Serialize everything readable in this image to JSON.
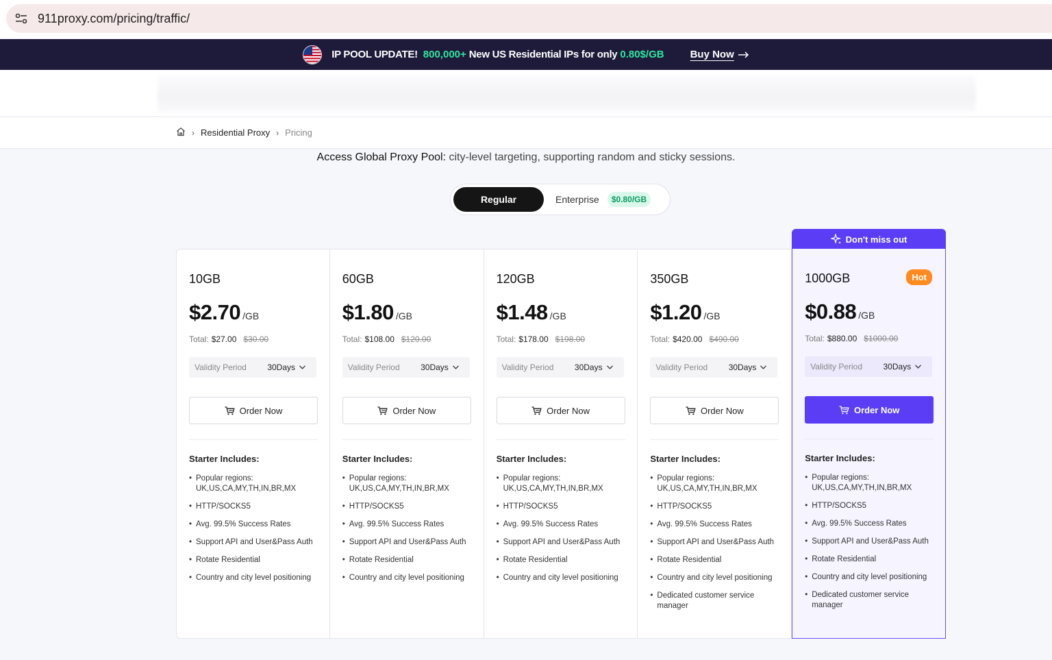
{
  "browser": {
    "url": "911proxy.com/pricing/traffic/"
  },
  "promo": {
    "headline": "IP POOL UPDATE!",
    "count": "800,000+",
    "text": "New US Residential IPs for only",
    "price": "0.80$/GB",
    "cta": "Buy Now"
  },
  "breadcrumb": {
    "items": [
      "Residential Proxy",
      "Pricing"
    ]
  },
  "subtitle": {
    "strong": "Access Global Proxy Pool:",
    "rest": " city-level targeting, supporting random and sticky sessions."
  },
  "plan_toggle": {
    "regular": "Regular",
    "enterprise": "Enterprise",
    "enterprise_badge": "$0.80/GB"
  },
  "ribbon": "Don't miss out",
  "cards": [
    {
      "gb": "10GB",
      "price": "$2.70",
      "unit": "/GB",
      "total_label": "Total:",
      "total": "$27.00",
      "old": "$30.00",
      "validity_label": "Validity Period",
      "validity": "30Days",
      "order": "Order Now",
      "includes": "Starter Includes:",
      "features": [
        "Popular regions: UK,US,CA,MY,TH,IN,BR,MX",
        "HTTP/SOCKS5",
        "Avg. 99.5% Success Rates",
        "Support API and User&Pass Auth",
        "Rotate Residential",
        "Country and city level positioning"
      ]
    },
    {
      "gb": "60GB",
      "price": "$1.80",
      "unit": "/GB",
      "total_label": "Total:",
      "total": "$108.00",
      "old": "$120.00",
      "validity_label": "Validity Period",
      "validity": "30Days",
      "order": "Order Now",
      "includes": "Starter Includes:",
      "features": [
        "Popular regions: UK,US,CA,MY,TH,IN,BR,MX",
        "HTTP/SOCKS5",
        "Avg. 99.5% Success Rates",
        "Support API and User&Pass Auth",
        "Rotate Residential",
        "Country and city level positioning"
      ]
    },
    {
      "gb": "120GB",
      "price": "$1.48",
      "unit": "/GB",
      "total_label": "Total:",
      "total": "$178.00",
      "old": "$198.00",
      "validity_label": "Validity Period",
      "validity": "30Days",
      "order": "Order Now",
      "includes": "Starter Includes:",
      "features": [
        "Popular regions: UK,US,CA,MY,TH,IN,BR,MX",
        "HTTP/SOCKS5",
        "Avg. 99.5% Success Rates",
        "Support API and User&Pass Auth",
        "Rotate Residential",
        "Country and city level positioning"
      ]
    },
    {
      "gb": "350GB",
      "price": "$1.20",
      "unit": "/GB",
      "total_label": "Total:",
      "total": "$420.00",
      "old": "$490.00",
      "validity_label": "Validity Period",
      "validity": "30Days",
      "order": "Order Now",
      "includes": "Starter Includes:",
      "features": [
        "Popular regions: UK,US,CA,MY,TH,IN,BR,MX",
        "HTTP/SOCKS5",
        "Avg. 99.5% Success Rates",
        "Support API and User&Pass Auth",
        "Rotate Residential",
        "Country and city level positioning",
        "Dedicated customer service manager"
      ]
    },
    {
      "gb": "1000GB",
      "hot": "Hot",
      "price": "$0.88",
      "unit": "/GB",
      "total_label": "Total:",
      "total": "$880.00",
      "old": "$1000.00",
      "validity_label": "Validity Period",
      "validity": "30Days",
      "order": "Order Now",
      "includes": "Starter Includes:",
      "features": [
        "Popular regions: UK,US,CA,MY,TH,IN,BR,MX",
        "HTTP/SOCKS5",
        "Avg. 99.5% Success Rates",
        "Support API and User&Pass Auth",
        "Rotate Residential",
        "Country and city level positioning",
        "Dedicated customer service manager"
      ]
    }
  ],
  "colors": {
    "accent": "#5b3df5",
    "banner_bg": "#1e1b3a",
    "banner_green": "#2ee8a0",
    "hot": "#ff8a1f",
    "badge_green": "#0d9a63"
  },
  "icons": {
    "site_info": "tune-icon",
    "home": "home-icon",
    "cart": "cart-icon",
    "sparkle": "sparkle-icon",
    "chevron": "chevron-down-icon",
    "arrow": "arrow-right-icon",
    "flag": "us-flag-icon"
  }
}
